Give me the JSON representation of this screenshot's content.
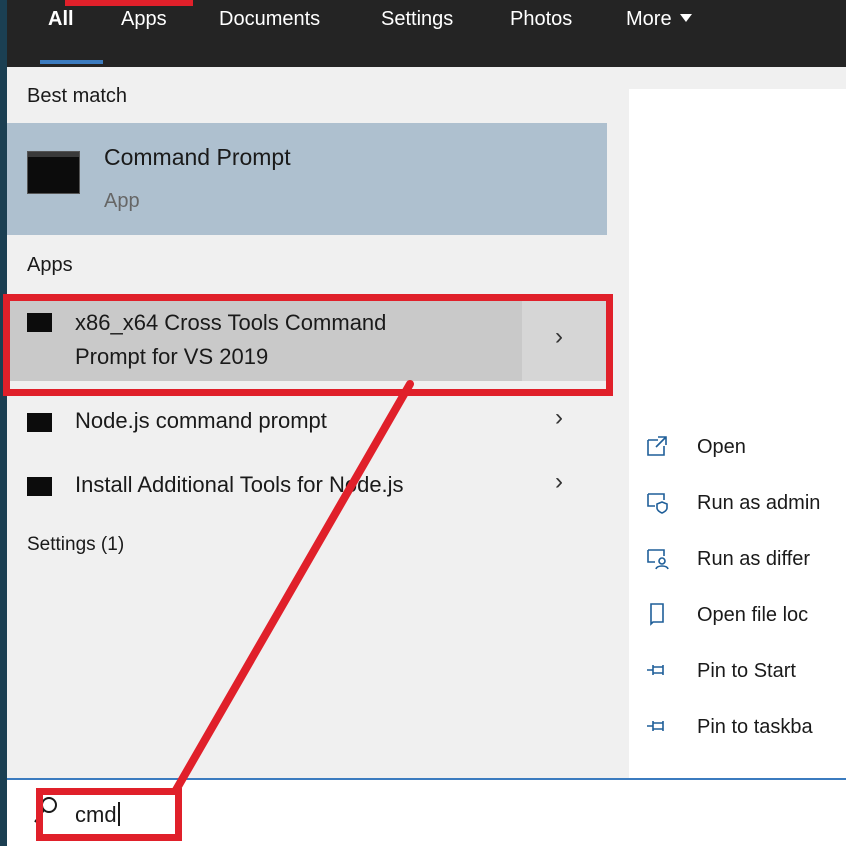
{
  "tabs": [
    {
      "label": "All",
      "active": true
    },
    {
      "label": "Apps"
    },
    {
      "label": "Documents"
    },
    {
      "label": "Settings"
    },
    {
      "label": "Photos"
    },
    {
      "label": "More"
    }
  ],
  "sections": {
    "best_match": "Best match",
    "apps": "Apps",
    "settings": "Settings (1)"
  },
  "best_match": {
    "name": "Command Prompt",
    "type": "App",
    "icon": "terminal-icon"
  },
  "apps": [
    {
      "line1": "x86_x64 Cross Tools Command",
      "line2": "Prompt for VS 2019",
      "icon": "terminal-icon",
      "selected": true
    },
    {
      "label": "Node.js command prompt",
      "icon": "terminal-icon"
    },
    {
      "label": "Install Additional Tools for Node.js",
      "icon": "terminal-icon"
    }
  ],
  "actions": [
    {
      "label": "Open",
      "icon": "open-external-icon"
    },
    {
      "label": "Run as admin",
      "icon": "shield-run-icon"
    },
    {
      "label": "Run as differ",
      "icon": "user-run-icon"
    },
    {
      "label": "Open file loc",
      "icon": "folder-location-icon"
    },
    {
      "label": "Pin to Start",
      "icon": "pin-icon"
    },
    {
      "label": "Pin to taskba",
      "icon": "pin-icon"
    }
  ],
  "search": {
    "value": "cmd",
    "icon": "search-icon"
  },
  "colors": {
    "accent": "#3b7bbf",
    "annotation": "#e0202a",
    "highlight": "#aec0cf",
    "topbar": "#242424"
  }
}
